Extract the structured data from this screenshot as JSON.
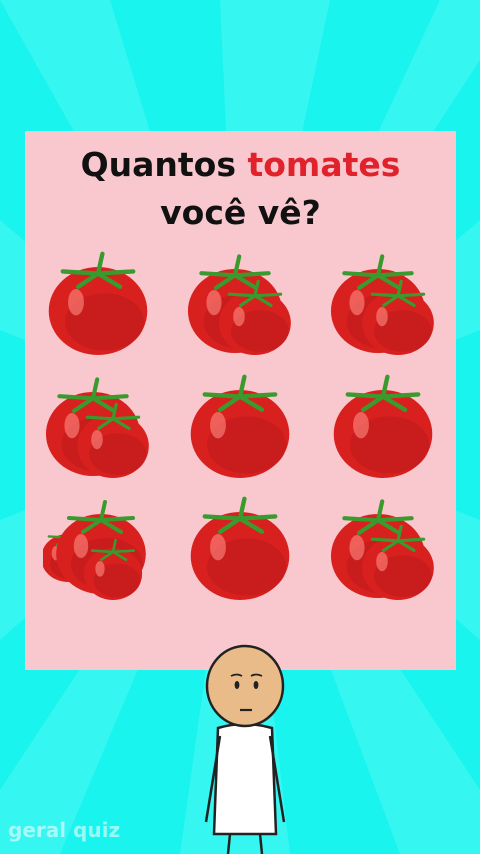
{
  "quiz": {
    "question_part1": "Quantos ",
    "question_highlight": "tomates",
    "question_part2": "você vê?",
    "highlight_color": "#e0222c",
    "background_color": "#19f4ee",
    "card_color": "#f9c8cf"
  },
  "grid": {
    "rows": 3,
    "columns": 3,
    "cells": [
      {
        "tomatoes": 1
      },
      {
        "tomatoes": 2
      },
      {
        "tomatoes": 2
      },
      {
        "tomatoes": 2
      },
      {
        "tomatoes": 1
      },
      {
        "tomatoes": 1
      },
      {
        "tomatoes": 3
      },
      {
        "tomatoes": 1
      },
      {
        "tomatoes": 2
      }
    ],
    "icon": "tomato-icon"
  },
  "watermark": "geral quiz"
}
